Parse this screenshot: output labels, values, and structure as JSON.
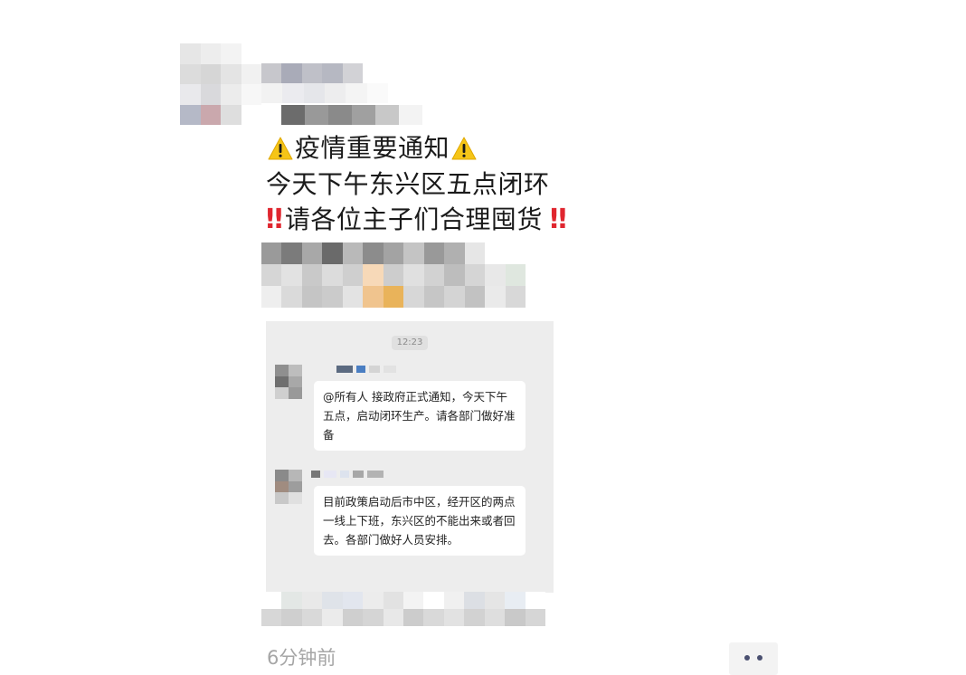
{
  "post": {
    "line1_text": "疫情重要通知",
    "line2_text": "今天下午东兴区五点闭环",
    "line3_text": "请各位主子们合理囤货",
    "double_bang": "‼",
    "warning_icon": "warning-triangle-icon"
  },
  "screenshot": {
    "time": "12:23",
    "message1": "@所有人 接政府正式通知，今天下午五点，启动闭环生产。请各部门做好准备",
    "message2": "目前政策启动后市中区，经开区的两点一线上下班，东兴区的不能出来或者回去。各部门做好人员安排。"
  },
  "footer": {
    "time_ago": "6分钟前"
  },
  "colors": {
    "warning_yellow": "#f5c518",
    "bang_red": "#e0262f",
    "chat_bg": "#ededed",
    "bubble_bg": "#ffffff"
  }
}
